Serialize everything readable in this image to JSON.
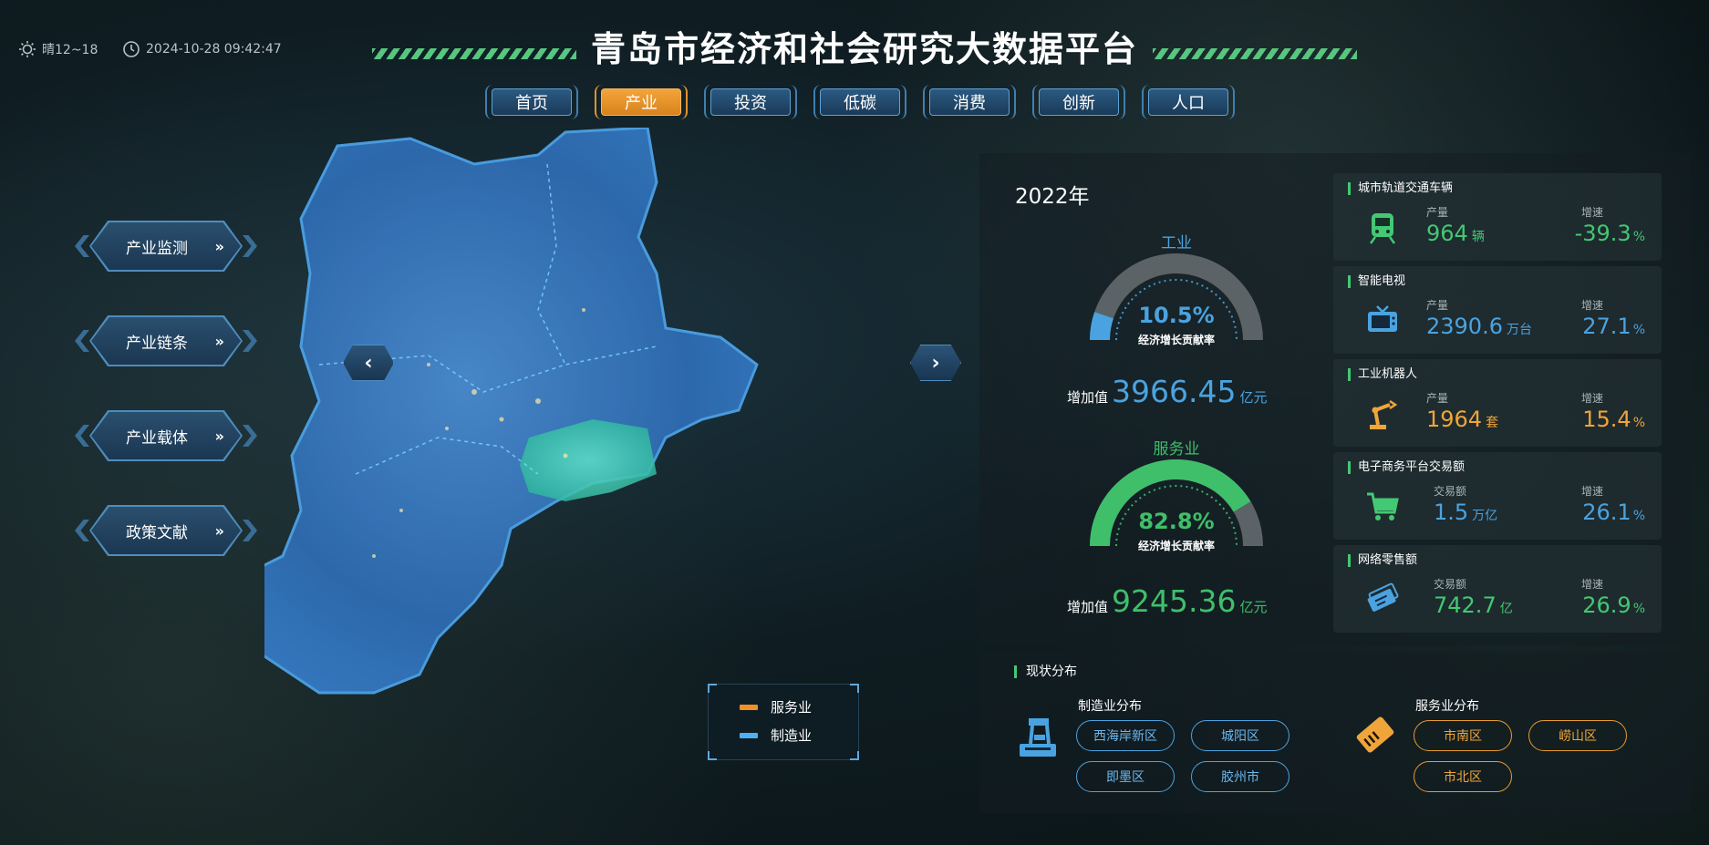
{
  "header": {
    "weather": "晴12~18",
    "datetime": "2024-10-28 09:42:47",
    "title": "青岛市经济和社会研究大数据平台"
  },
  "nav": {
    "items": [
      "首页",
      "产业",
      "投资",
      "低碳",
      "消费",
      "创新",
      "人口"
    ],
    "active": "产业"
  },
  "side_menu": {
    "items": [
      "产业监测",
      "产业链条",
      "产业载体",
      "政策文献"
    ],
    "arrow": "»"
  },
  "map": {
    "prev": "‹",
    "next": "›",
    "legend": [
      {
        "label": "服务业",
        "color": "#f28f24"
      },
      {
        "label": "制造业",
        "color": "#4fb0ef"
      }
    ]
  },
  "overview": {
    "year": "2022年",
    "industry": {
      "title": "工业",
      "rate": "10.5%",
      "rate_value": 10.5,
      "rate_label": "经济增长贡献率",
      "added_label": "增加值",
      "added_value": "3966.45",
      "unit": "亿元",
      "color": "#4aa3e0"
    },
    "service": {
      "title": "服务业",
      "rate": "82.8%",
      "rate_value": 82.8,
      "rate_label": "经济增长贡献率",
      "added_label": "增加值",
      "added_value": "9245.36",
      "unit": "亿元",
      "color": "#3fbf6a"
    }
  },
  "cards": [
    {
      "title": "城市轨道交通车辆",
      "icon": "train-icon",
      "label1": "产量",
      "value1": "964",
      "unit1": "辆",
      "label2": "增速",
      "value2": "-39.3",
      "unit2": "%",
      "color": "#43c873"
    },
    {
      "title": "智能电视",
      "icon": "tv-icon",
      "label1": "产量",
      "value1": "2390.6",
      "unit1": "万台",
      "label2": "增速",
      "value2": "27.1",
      "unit2": "%",
      "color": "#4aa3e0"
    },
    {
      "title": "工业机器人",
      "icon": "robot-arm-icon",
      "label1": "产量",
      "value1": "1964",
      "unit1": "套",
      "label2": "增速",
      "value2": "15.4",
      "unit2": "%",
      "color": "#f0a53a"
    },
    {
      "title": "电子商务平台交易额",
      "icon": "cart-icon",
      "label1": "交易额",
      "value1": "1.5",
      "unit1": "万亿",
      "label2": "增速",
      "value2": "26.1",
      "unit2": "%",
      "color": "#4aa3e0"
    },
    {
      "title": "网络零售额",
      "icon": "ticket-icon",
      "label1": "交易额",
      "value1": "742.7",
      "unit1": "亿",
      "label2": "增速",
      "value2": "26.9",
      "unit2": "%",
      "color": "#43c873"
    }
  ],
  "distribution": {
    "title": "现状分布",
    "manufacturing": {
      "title": "制造业分布",
      "tags": [
        "西海岸新区",
        "城阳区",
        "即墨区",
        "胶州市"
      ]
    },
    "service": {
      "title": "服务业分布",
      "tags": [
        "市南区",
        "崂山区",
        "市北区"
      ]
    }
  }
}
